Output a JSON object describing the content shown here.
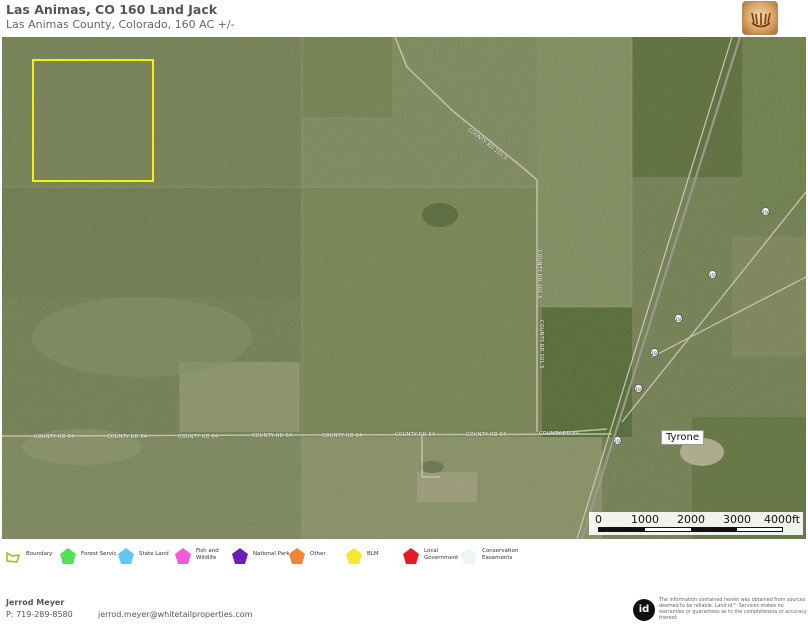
{
  "header": {
    "title": "Las Animas, CO 160 Land Jack",
    "subtitle": "Las Animas County, Colorado, 160 AC +/-",
    "logo_icon": "antler-logo-icon"
  },
  "map": {
    "road_labels": {
      "cr64_a": "COUNTY RD 64",
      "cr64_b": "COUNTY RD 64",
      "cr64_c": "COUNTY RD 64",
      "cr64_d": "COUNTY RD 64",
      "cr64_e": "COUNTY RD 64",
      "cr64_f": "COUNTY RD 64",
      "cr64_g": "COUNTY RD 64",
      "cr64_h": "COUNTY RD 64",
      "cr101_a": "COUNTY RD 101.5",
      "cr101_b": "COUNTY RD 101.5",
      "cr101_c": "COUNTY RD 101.5"
    },
    "shields": [
      "350",
      "350",
      "350",
      "350",
      "350",
      "350"
    ],
    "place_label": "Tyrone",
    "boundary_color": "#f5f20a",
    "scale": {
      "labels": [
        "0",
        "1000",
        "2000",
        "3000",
        "4000ft"
      ]
    }
  },
  "legend": [
    {
      "label": "Boundary",
      "color": "#ffff00",
      "icon": "boundary-icon"
    },
    {
      "label": "Forest Servic",
      "color": "#55e05a",
      "icon": "pentagon-icon"
    },
    {
      "label": "State Land",
      "color": "#5fc8f2",
      "icon": "pentagon-icon"
    },
    {
      "label": "Fish and Wildlife",
      "color": "#f25cd9",
      "icon": "pentagon-icon"
    },
    {
      "label": "National Park",
      "color": "#6a1fb5",
      "icon": "pentagon-icon"
    },
    {
      "label": "Other",
      "color": "#f2843a",
      "icon": "pentagon-icon"
    },
    {
      "label": "BLM",
      "color": "#f5e92a",
      "icon": "pentagon-icon"
    },
    {
      "label": "Local Government",
      "color": "#e31b23",
      "icon": "pentagon-icon"
    },
    {
      "label": "Conservation Easements",
      "color": "#eef4fa",
      "icon": "pentagon-icon"
    }
  ],
  "footer": {
    "agent_name": "Jerrod Meyer",
    "phone": "P: 719-289-8580",
    "email": "jerrod.meyer@whitetailproperties.com",
    "id_logo": "id",
    "disclaimer": "The information contained herein was obtained from sources deemed to be reliable. Land id™ Services makes no warranties or guarantees as to the completeness or accuracy thereof."
  }
}
